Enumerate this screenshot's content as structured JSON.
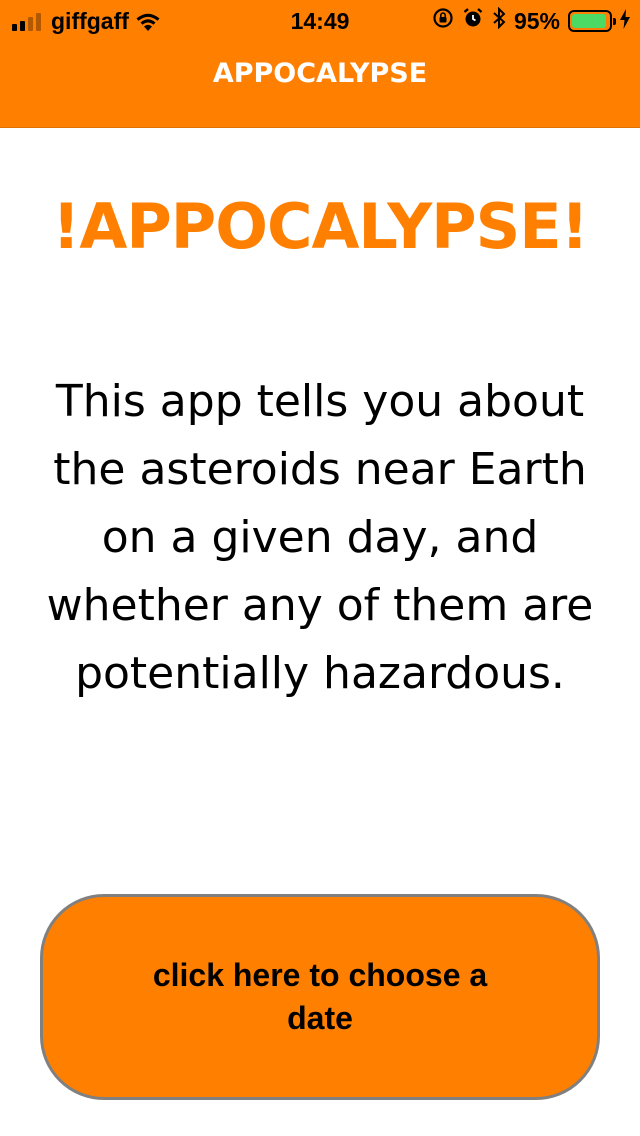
{
  "status_bar": {
    "carrier": "giffgaff",
    "time": "14:49",
    "battery_percent": "95%",
    "battery_level": 0.95,
    "icons": [
      "signal-icon",
      "wifi-icon",
      "rotation-lock-icon",
      "alarm-icon",
      "bluetooth-icon",
      "battery-icon",
      "charging-icon"
    ]
  },
  "nav": {
    "title": "APPOCALYPSE"
  },
  "hero": {
    "title": "!APPOCALYPSE!"
  },
  "main": {
    "description": "This app tells you about the asteroids near Earth on a given day, and whether any of them are potentially hazardous."
  },
  "actions": {
    "choose_date_label": "click here to choose a date"
  },
  "colors": {
    "accent": "#ff7f00",
    "button_border": "#808080",
    "battery_fill": "#4cd964"
  }
}
